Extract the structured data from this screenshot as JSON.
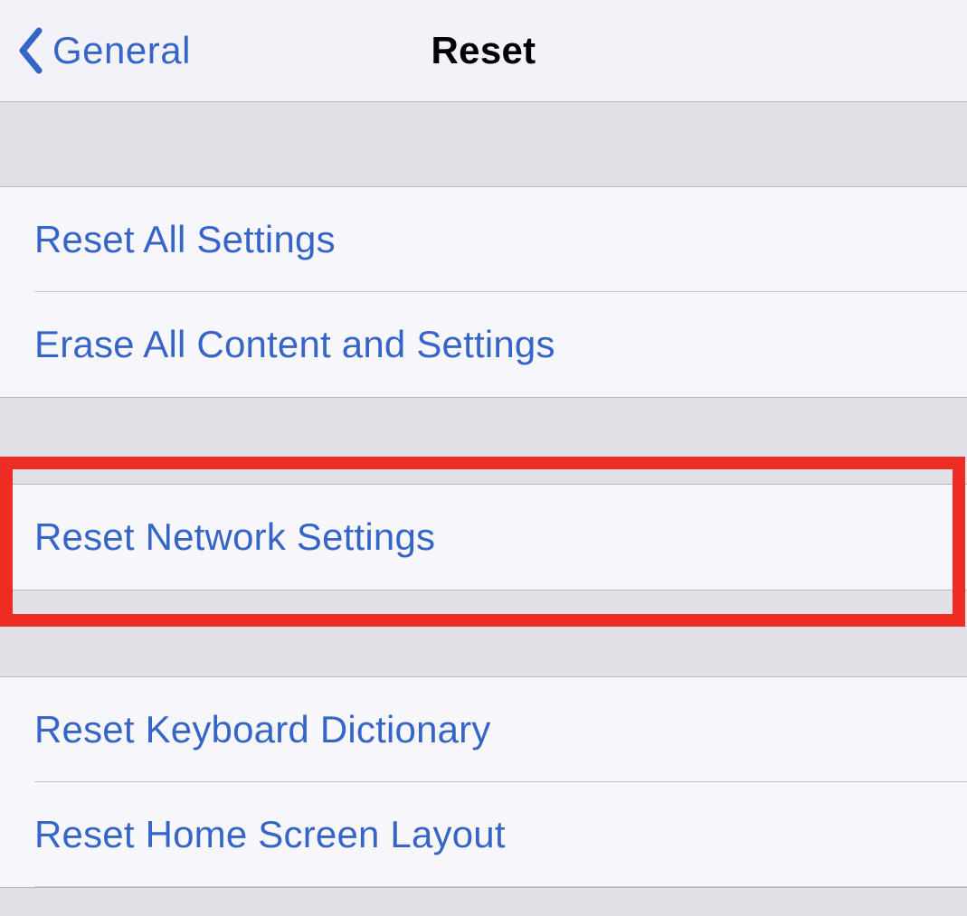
{
  "nav": {
    "back_label": "General",
    "title": "Reset"
  },
  "sections": {
    "group1": {
      "items": [
        {
          "label": "Reset All Settings"
        },
        {
          "label": "Erase All Content and Settings"
        }
      ]
    },
    "group2": {
      "items": [
        {
          "label": "Reset Network Settings"
        }
      ]
    },
    "group3": {
      "items": [
        {
          "label": "Reset Keyboard Dictionary"
        },
        {
          "label": "Reset Home Screen Layout"
        }
      ]
    }
  }
}
